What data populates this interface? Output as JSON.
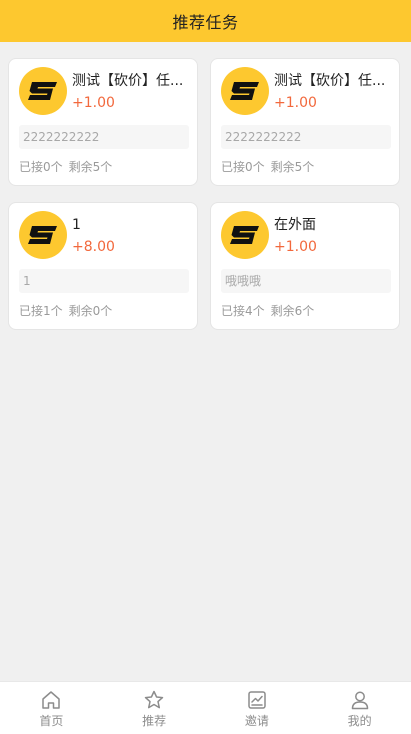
{
  "header": {
    "title": "推荐任务"
  },
  "colors": {
    "brand_yellow": "#fdc82f",
    "reward_orange": "#f2683c",
    "page_background": "#f0f0f0"
  },
  "tasks": [
    {
      "title": "测试【砍价】任...",
      "reward": "+1.00",
      "description": "2222222222",
      "accepted": "已接0个",
      "remaining": "剩余5个",
      "icon": "s-logo-icon"
    },
    {
      "title": "测试【砍价】任...",
      "reward": "+1.00",
      "description": "2222222222",
      "accepted": "已接0个",
      "remaining": "剩余5个",
      "icon": "s-logo-icon"
    },
    {
      "title": "1",
      "reward": "+8.00",
      "description": "1",
      "accepted": "已接1个",
      "remaining": "剩余0个",
      "icon": "s-logo-icon"
    },
    {
      "title": "在外面",
      "reward": "+1.00",
      "description": "哦哦哦",
      "accepted": "已接4个",
      "remaining": "剩余6个",
      "icon": "s-logo-icon"
    }
  ],
  "tabbar": {
    "items": [
      {
        "label": "首页",
        "icon": "home-icon"
      },
      {
        "label": "推荐",
        "icon": "star-icon"
      },
      {
        "label": "邀请",
        "icon": "invite-chart-icon"
      },
      {
        "label": "我的",
        "icon": "user-icon"
      }
    ]
  }
}
